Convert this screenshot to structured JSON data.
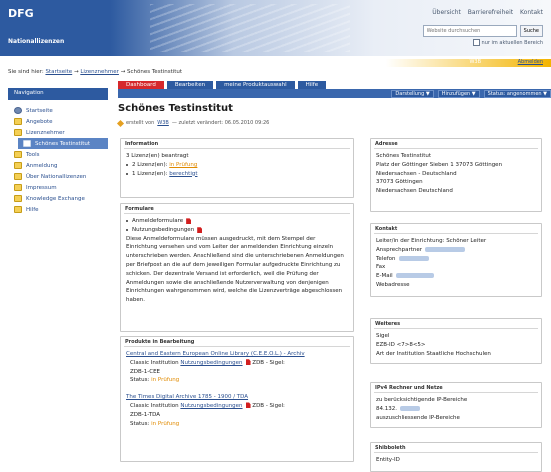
{
  "header": {
    "logo": "DFG",
    "subtitle": "Nationallizenzen",
    "links": [
      "Übersicht",
      "Barrierefreiheit",
      "Kontakt"
    ],
    "search_placeholder": "Website durchsuchen",
    "search_button": "Suche",
    "area_checkbox_label": "nur im aktuellen Bereich"
  },
  "userbar": {
    "user": "W3B",
    "logout": "Abmelden"
  },
  "breadcrumb": {
    "prefix": "Sie sind hier:",
    "items": [
      "Startseite",
      "Lizenznehmer",
      "Schönes Testinstitut"
    ],
    "separator": "→"
  },
  "sidebar": {
    "title": "Navigation",
    "items": [
      {
        "label": "Startseite",
        "icon": "home-icon"
      },
      {
        "label": "Angebote",
        "icon": "folder-icon"
      },
      {
        "label": "Lizenznehmer",
        "icon": "folder-icon"
      },
      {
        "label": "Schönes Testinstitut",
        "icon": "folder-icon"
      },
      {
        "label": "Tools",
        "icon": "folder-icon"
      },
      {
        "label": "Anmeldung",
        "icon": "folder-icon"
      },
      {
        "label": "Über Nationallizenzen",
        "icon": "folder-icon"
      },
      {
        "label": "Impressum",
        "icon": "folder-icon"
      },
      {
        "label": "Knowledge Exchange",
        "icon": "folder-icon"
      },
      {
        "label": "Hilfe",
        "icon": "folder-icon"
      }
    ]
  },
  "tabs": [
    "Dashboard",
    "Bearbeiten",
    "meine Produktauswahl",
    "Hilfe"
  ],
  "actions": {
    "display": "Darstellung ▼",
    "add": "Hinzufügen ▼",
    "status": "Status: angenommen ▼"
  },
  "page": {
    "title": "Schönes Testinstitut",
    "meta_created": "erstellt von",
    "meta_user": "W3B",
    "meta_modified": "— zuletzt verändert: 06.05.2010 09:26"
  },
  "information": {
    "title": "Information",
    "summary": "3 Lizenz(en) beantragt",
    "items": [
      {
        "text": "2 Lizenz(en):",
        "status": "in Prüfung"
      },
      {
        "text": "1 Lizenz(en):",
        "status": "berechtigt"
      }
    ]
  },
  "formulare": {
    "title": "Formulare",
    "items": [
      "Anmeldeformulare",
      "Nutzungsbedingungen"
    ],
    "text": "Diese Anmeldeformulare müssen ausgedruckt, mit dem Stempel der Einrichtung versehen und vom Leiter der anmeldenden Einrichtung einzeln unterschrieben werden. Anschließend sind die unterschriebenen Anmeldungen per Briefpost an die auf dem jeweiligen Formular aufgedruckte Einrichtung zu schicken. Der dezentrale Versand ist erforderlich, weil die Prüfung der Anmeldungen sowie die anschließende Nutzerverwaltung von denjenigen Einrichtungen wahrgenommen wird, welche die Lizenzverträge abgeschlossen haben."
  },
  "produkte": {
    "title": "Produkte in Bearbeitung",
    "items": [
      {
        "name": "Central and Eastern European Online Library (C.E.E.O.L.) - Archiv",
        "classic": "Classic Institution",
        "link": "Nutzungsbedingungen",
        "zdb_label": "ZDB - Sigel:",
        "zdb_value": "ZDB-1-CEE",
        "status_label": "Status:",
        "status": "in Prüfung"
      },
      {
        "name": "The Times Digital Archive 1785 - 1900 / TDA",
        "classic": "Classic Institution",
        "link": "Nutzungsbedingungen",
        "zdb_label": "ZDB - Sigel:",
        "zdb_value": "ZDB-1-TDA",
        "status_label": "Status:",
        "status": "in Prüfung"
      }
    ]
  },
  "adresse": {
    "title": "Adresse",
    "lines": [
      "Schönes Testinstitut",
      "Platz der Göttinger Sieben 1 37073 Göttingen",
      "Niedersachsen - Deutschland",
      "37073 Göttingen",
      "Niedersachsen Deutschland"
    ]
  },
  "kontakt": {
    "title": "Kontakt",
    "lines": [
      "Leiter/in der Einrichtung: Schöner Leiter",
      "Ansprechpartner",
      "Telefon",
      "Fax",
      "E-Mail",
      "Webadresse"
    ]
  },
  "weiteres": {
    "title": "Weiteres",
    "lines": [
      "Sigel",
      "EZB-ID <7>8<5>",
      "Art der Institution Staatliche Hochschulen"
    ]
  },
  "ipv4": {
    "title": "IPv4 Rechner und Netze",
    "lines": [
      "zu berücksichtigende IP-Bereiche",
      "84.132.",
      "auszuschliessende IP-Bereiche"
    ]
  },
  "shibboleth": {
    "title": "Shibboleth",
    "lines": [
      "Entity-ID"
    ]
  },
  "colors": {
    "brand": "#2d5aa0",
    "tab_active": "#d6282c",
    "status_orange": "#e08a00"
  }
}
